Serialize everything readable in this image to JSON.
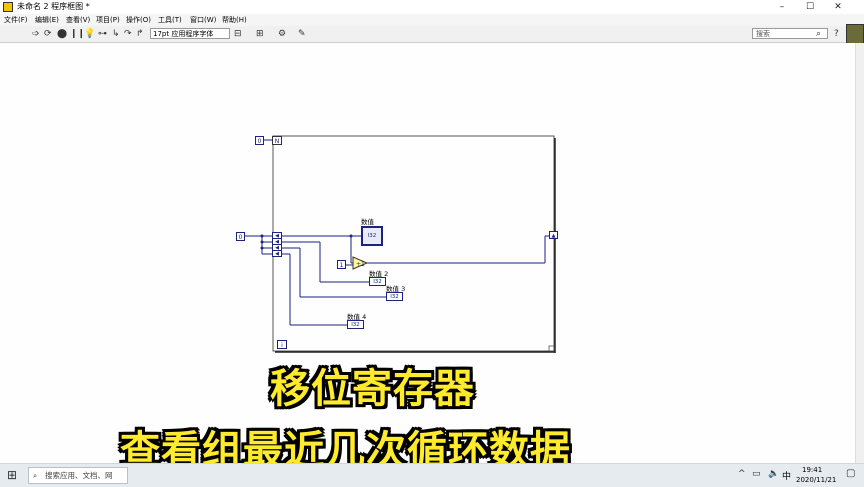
{
  "window": {
    "title": "未命名 2 程序框图 *",
    "controls": [
      "–",
      "☐",
      "✕"
    ]
  },
  "menu": [
    "文件(F)",
    "编辑(E)",
    "查看(V)",
    "项目(P)",
    "操作(O)",
    "工具(T)",
    "窗口(W)",
    "帮助(H)"
  ],
  "toolbar": {
    "font": "17pt 应用程序字体",
    "search_placeholder": "搜索"
  },
  "diagram": {
    "n_constant": "0",
    "n_terminal": "N",
    "input_constant": "0",
    "increment_constant": "1",
    "iteration_terminal": "i",
    "indicators": [
      {
        "label": "数值",
        "value": "I32"
      },
      {
        "label": "数值 2",
        "value": "I32"
      },
      {
        "label": "数值 3",
        "value": "I32"
      },
      {
        "label": "数值 4",
        "value": "I32"
      }
    ]
  },
  "overlay": {
    "line1": "移位寄存器",
    "line2": "查看组最近几次循环数据"
  },
  "taskbar": {
    "search_placeholder": "搜索应用、文档、网",
    "ime": "中",
    "time": "19:41",
    "date": "2020/11/21"
  },
  "colors": {
    "wire": "#1a237e",
    "overlay_text": "#ffeb2c",
    "titlebar_icon": "#f4c20d"
  }
}
